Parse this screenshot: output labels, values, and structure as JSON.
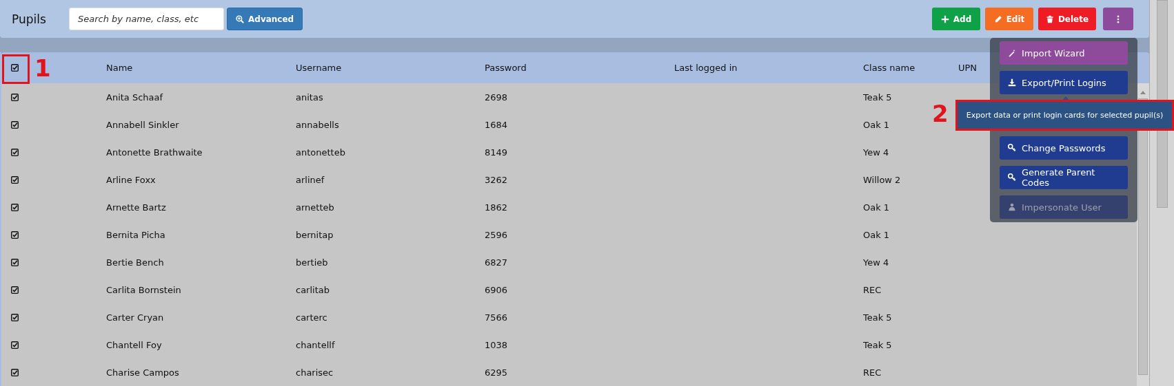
{
  "toolbar": {
    "title": "Pupils",
    "search": {
      "placeholder": "Search by name, class, etc"
    },
    "advanced_button": "Advanced",
    "buttons": [
      {
        "kind": "add",
        "label": "Add"
      },
      {
        "kind": "edit",
        "label": "Edit"
      },
      {
        "kind": "delete",
        "label": "Delete"
      },
      {
        "kind": "more"
      }
    ]
  },
  "table": {
    "select_all": {
      "checked": true
    },
    "columns": [
      "Name",
      "Username",
      "Password",
      "Last logged in",
      "Class name",
      "UPN"
    ],
    "rows": [
      {
        "checked": true,
        "cells": [
          "Anita Schaaf",
          "anitas",
          "2698",
          "",
          "Teak 5"
        ]
      },
      {
        "checked": true,
        "cells": [
          "Annabell Sinkler",
          "annabells",
          "1684",
          "",
          "Oak 1"
        ]
      },
      {
        "checked": true,
        "cells": [
          "Antonette Brathwaite",
          "antonetteb",
          "8149",
          "",
          "Yew 4"
        ]
      },
      {
        "checked": true,
        "cells": [
          "Arline Foxx",
          "arlinef",
          "3262",
          "",
          "Willow 2"
        ]
      },
      {
        "checked": true,
        "cells": [
          "Arnette Bartz",
          "arnetteb",
          "1862",
          "",
          "Oak 1"
        ]
      },
      {
        "checked": true,
        "cells": [
          "Bernita Picha",
          "bernitap",
          "2596",
          "",
          "Oak 1"
        ]
      },
      {
        "checked": true,
        "cells": [
          "Bertie Bench",
          "bertieb",
          "6827",
          "",
          "Yew 4"
        ]
      },
      {
        "checked": true,
        "cells": [
          "Carlita Bornstein",
          "carlitab",
          "6906",
          "",
          "REC"
        ]
      },
      {
        "checked": true,
        "cells": [
          "Carter Cryan",
          "carterc",
          "7566",
          "",
          "Teak 5"
        ]
      },
      {
        "checked": true,
        "cells": [
          "Chantell Foy",
          "chantellf",
          "1038",
          "",
          "Teak 5"
        ]
      },
      {
        "checked": true,
        "cells": [
          "Charise Campos",
          "charisec",
          "6295",
          "",
          "REC"
        ]
      }
    ]
  },
  "menu": {
    "items": [
      {
        "kind": "wand",
        "label": "Import Wizard",
        "disabled": false
      },
      {
        "kind": "download",
        "label": "Export/Print Logins",
        "disabled": false
      },
      {
        "kind": "key",
        "label": "Change Passwords",
        "disabled": false
      },
      {
        "kind": "key",
        "label": "Generate Parent Codes",
        "disabled": false
      },
      {
        "kind": "user",
        "label": "Impersonate User",
        "disabled": true
      }
    ]
  },
  "tooltip": "Export data or print login cards for selected pupil(s)",
  "annotations": [
    {
      "label": "1"
    },
    {
      "label": "2"
    }
  ]
}
